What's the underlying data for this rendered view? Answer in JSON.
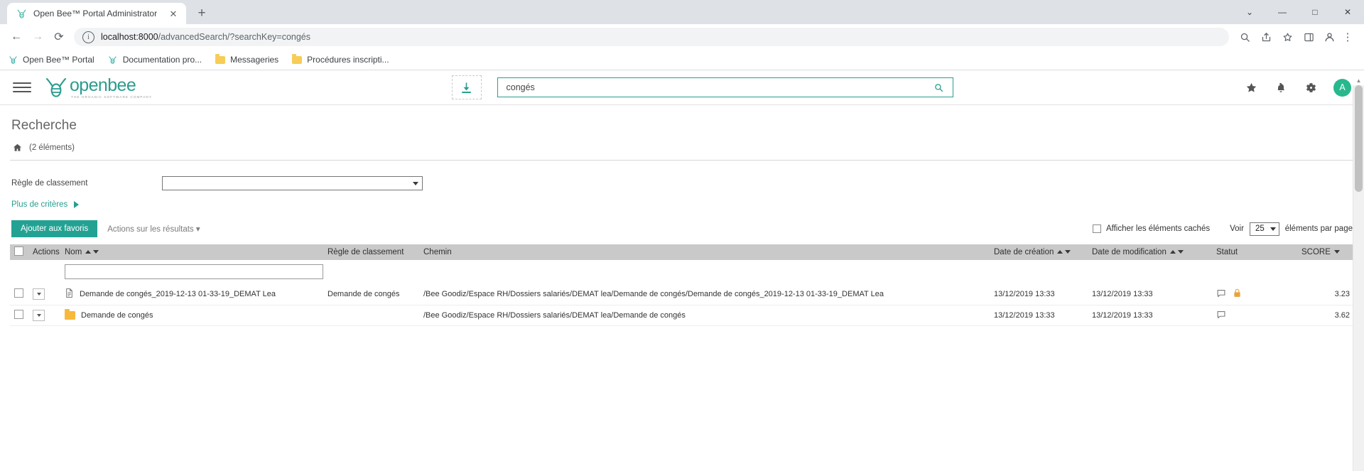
{
  "browser": {
    "tab": {
      "title": "Open Bee™ Portal Administrator",
      "favicon": "bee-icon",
      "close": "✕"
    },
    "new_tab": "+",
    "window_controls": {
      "minimize": "—",
      "maximize": "□",
      "close": "✕",
      "chevron": "⌄"
    },
    "nav": {
      "back": "←",
      "forward": "→",
      "reload": "⟳"
    },
    "omnibox": {
      "info_icon": "ⓘ",
      "url_host": "localhost:8000",
      "url_path": "/advancedSearch/?searchKey=congés"
    },
    "toolbar_icons": [
      {
        "name": "search-icon",
        "glyph": "search"
      },
      {
        "name": "share-icon",
        "glyph": "share"
      },
      {
        "name": "bookmark-star-icon",
        "glyph": "star"
      },
      {
        "name": "sidepanel-icon",
        "glyph": "panel"
      },
      {
        "name": "profile-icon",
        "glyph": "person"
      }
    ],
    "bookmarks": [
      {
        "label": "Open Bee™ Portal",
        "icon": "bee-icon"
      },
      {
        "label": "Documentation pro...",
        "icon": "bee-icon"
      },
      {
        "label": "Messageries",
        "icon": "folder-icon"
      },
      {
        "label": "Procédures inscripti...",
        "icon": "folder-icon"
      }
    ]
  },
  "app_header": {
    "menu_icon": "hamburger-icon",
    "logo": {
      "word": "openbee",
      "tagline": "THE ORGANIC SOFTWARE COMPANY"
    },
    "import_icon": "download-import-icon",
    "search": {
      "value": "congés",
      "placeholder": "",
      "submit_icon": "search-icon"
    },
    "icons": [
      {
        "name": "favorites-star-icon",
        "glyph": "★"
      },
      {
        "name": "notifications-bell-icon",
        "glyph": "bell"
      },
      {
        "name": "settings-gear-icon",
        "glyph": "gear"
      }
    ],
    "avatar": {
      "initial": "A",
      "color": "#27b88e"
    }
  },
  "page": {
    "title": "Recherche",
    "breadcrumb": {
      "home_icon": "home-icon",
      "count": "(2 éléments)"
    },
    "criteria": {
      "label": "Règle de classement",
      "select_value": "",
      "more_label": "Plus de critères"
    },
    "actions": {
      "favorite_button": "Ajouter aux favoris",
      "results_menu": "Actions sur les résultats",
      "show_hidden_label": "Afficher les éléments cachés",
      "show_hidden_checked": false,
      "voir_label": "Voir",
      "per_page_value": "25",
      "per_page_suffix": "éléments par page"
    }
  },
  "table": {
    "columns": [
      {
        "key": "select",
        "label": ""
      },
      {
        "key": "actions",
        "label": "Actions"
      },
      {
        "key": "nom",
        "label": "Nom",
        "sortable": true
      },
      {
        "key": "regle",
        "label": "Règle de classement"
      },
      {
        "key": "chemin",
        "label": "Chemin"
      },
      {
        "key": "creation",
        "label": "Date de création",
        "sortable": true
      },
      {
        "key": "modification",
        "label": "Date de modification",
        "sortable": true
      },
      {
        "key": "statut",
        "label": "Statut"
      },
      {
        "key": "score",
        "label": "SCORE",
        "sortable": true
      }
    ],
    "name_filter_value": "",
    "rows": [
      {
        "icon": "document-icon",
        "nom": "Demande de congés_2019-12-13 01-33-19_DEMAT Lea",
        "regle": "Demande de congés",
        "chemin": "/Bee Goodiz/Espace RH/Dossiers salariés/DEMAT lea/Demande de congés/Demande de congés_2019-12-13 01-33-19_DEMAT Lea",
        "creation": "13/12/2019 13:33",
        "modification": "13/12/2019 13:33",
        "statut_icons": [
          "comment-icon",
          "lock-icon"
        ],
        "score": "3.23"
      },
      {
        "icon": "folder-icon",
        "nom": "Demande de congés",
        "regle": "",
        "chemin": "/Bee Goodiz/Espace RH/Dossiers salariés/DEMAT lea/Demande de congés",
        "creation": "13/12/2019 13:33",
        "modification": "13/12/2019 13:33",
        "statut_icons": [
          "comment-icon"
        ],
        "score": "3.62"
      }
    ]
  }
}
